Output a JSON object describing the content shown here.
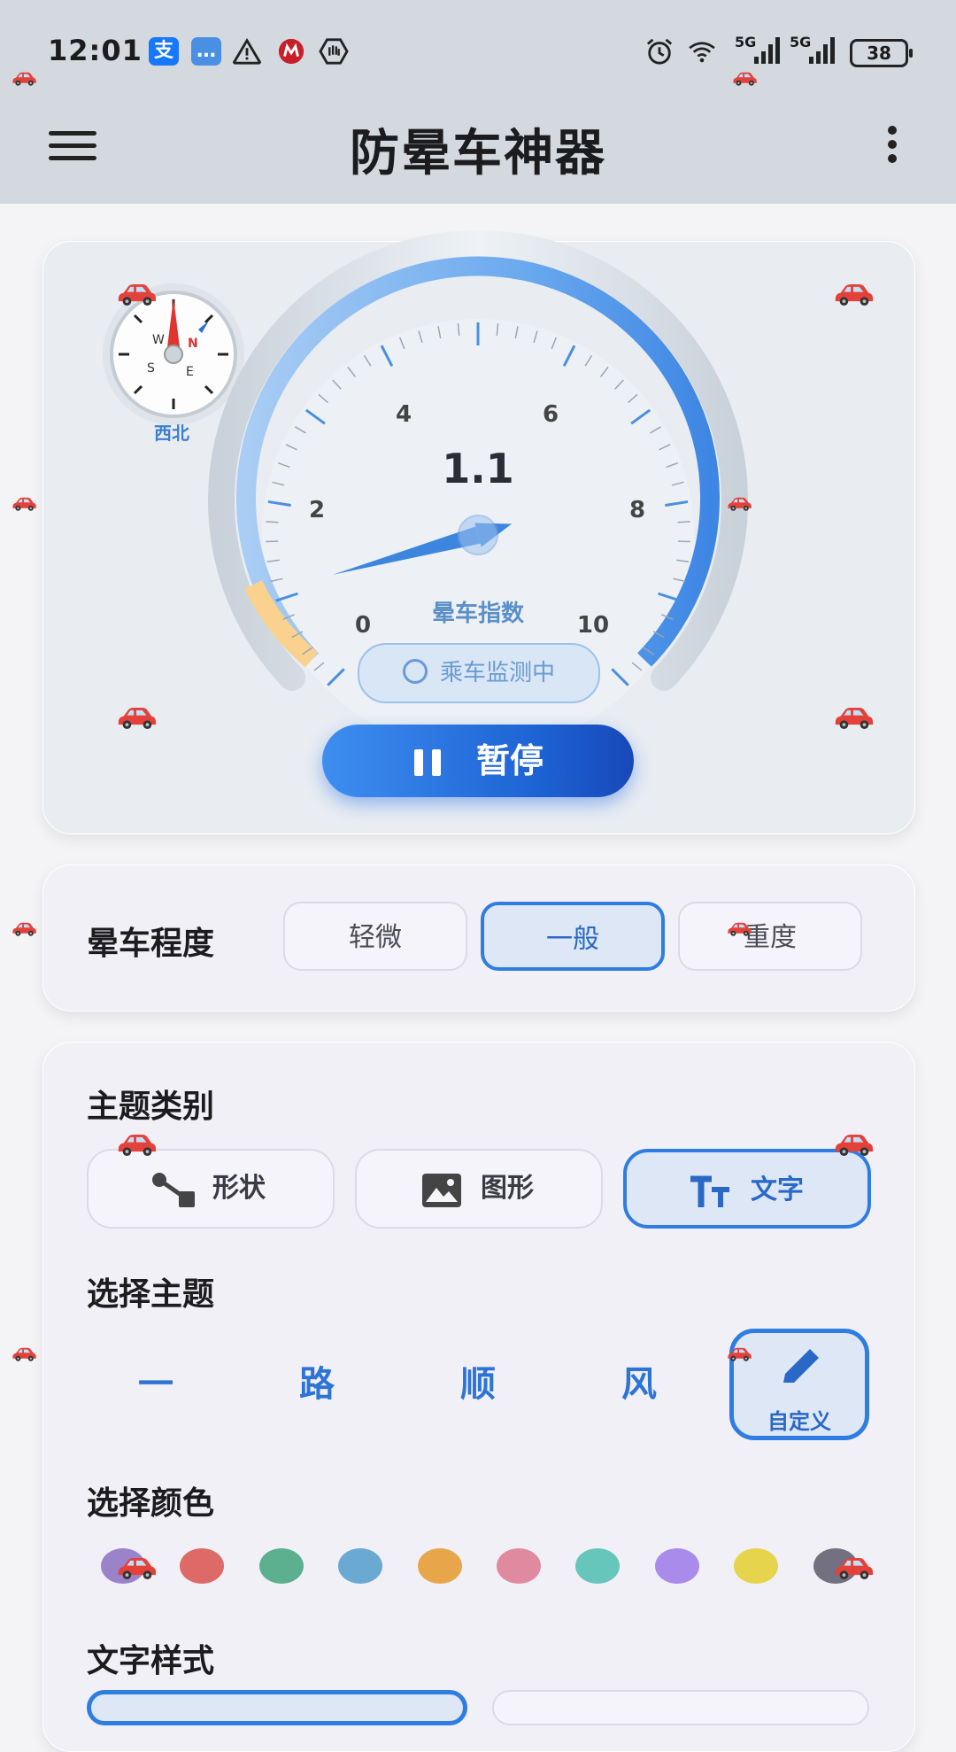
{
  "status_bar": {
    "time": "12:01",
    "battery": "38",
    "signal_labels": [
      "5G",
      "5G"
    ]
  },
  "app_bar": {
    "title": "防晕车神器"
  },
  "compass": {
    "direction": "西北",
    "letters": [
      "W",
      "N",
      "S",
      "E"
    ]
  },
  "gauge": {
    "value": "1.1",
    "label": "晕车指数",
    "ticks": [
      "0",
      "2",
      "4",
      "6",
      "8",
      "10"
    ],
    "needle_value": 1.1,
    "max": 10
  },
  "monitor": {
    "label": "乘车监测中"
  },
  "pause_button": {
    "label": "暂停"
  },
  "severity": {
    "label": "晕车程度",
    "options": [
      "轻微",
      "一般",
      "重度"
    ],
    "selected": "一般"
  },
  "theme_category": {
    "label": "主题类别",
    "options": [
      {
        "label": "形状",
        "icon": "shapes-icon"
      },
      {
        "label": "图形",
        "icon": "image-icon"
      },
      {
        "label": "文字",
        "icon": "text-icon"
      }
    ],
    "selected": "文字"
  },
  "theme_select": {
    "label": "选择主题",
    "chars": [
      "一",
      "路",
      "顺",
      "风"
    ],
    "custom_label": "自定义"
  },
  "color_select": {
    "label": "选择颜色",
    "colors": [
      "#9a83c9",
      "#dd6a66",
      "#5cb08f",
      "#6aa9d1",
      "#e8a64a",
      "#e08aa0",
      "#66c6bc",
      "#a98bec",
      "#e6d44c",
      "#737080"
    ]
  },
  "text_style": {
    "label": "文字样式"
  }
}
